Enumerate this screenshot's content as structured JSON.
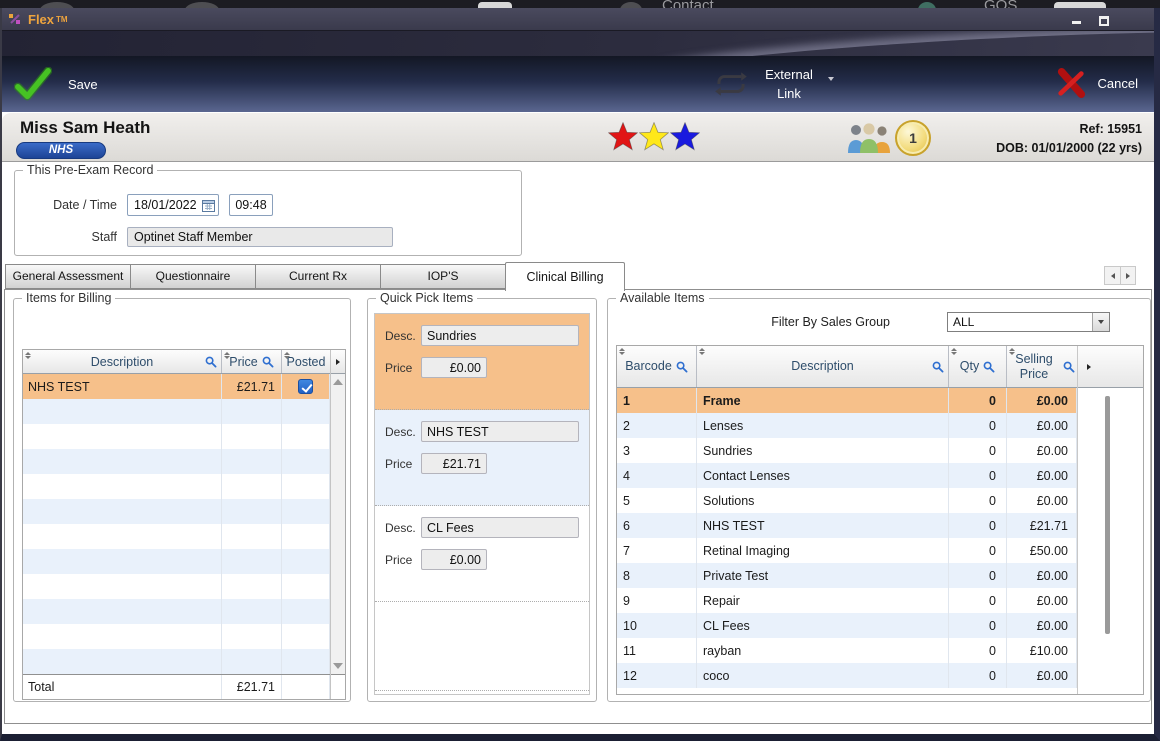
{
  "desktop": {
    "background_titles": [
      "Contact",
      "GOS"
    ]
  },
  "titlebar": {
    "app_name": "Flex",
    "trademark": "TM"
  },
  "toolbar": {
    "save": "Save",
    "external_link": "External Link",
    "cancel": "Cancel"
  },
  "patient": {
    "name": "Miss Sam Heath",
    "scheme_badge": "NHS",
    "ref": "Ref: 15951",
    "dob": "DOB: 01/01/2000 (22 yrs)",
    "link_count": "1",
    "star_colors": [
      "#e11515",
      "#ffe81a",
      "#1a1adf"
    ]
  },
  "pre_exam": {
    "legend": "This Pre-Exam Record",
    "date_time_label": "Date / Time",
    "date": "18/01/2022",
    "time": "09:48",
    "staff_label": "Staff",
    "staff": "Optinet Staff Member"
  },
  "tabs": {
    "items": [
      "General Assessment",
      "Questionnaire",
      "Current Rx",
      "IOP'S",
      "Clinical Billing"
    ],
    "active": "Clinical Billing"
  },
  "items_for_billing": {
    "legend": "Items for Billing",
    "columns": {
      "description": "Description",
      "price": "Price",
      "posted": "Posted"
    },
    "rows": [
      {
        "description": "NHS TEST",
        "price": "£21.71",
        "posted": true,
        "selected": true
      }
    ],
    "visible_rows": 12,
    "total_label": "Total",
    "total": "£21.71"
  },
  "quick_pick": {
    "legend": "Quick Pick Items",
    "desc_label": "Desc.",
    "price_label": "Price",
    "items": [
      {
        "desc": "Sundries",
        "price": "£0.00",
        "highlight": "orange"
      },
      {
        "desc": "NHS TEST",
        "price": "£21.71",
        "highlight": "blue"
      },
      {
        "desc": "CL Fees",
        "price": "£0.00",
        "highlight": "none"
      }
    ]
  },
  "available_items": {
    "legend": "Available Items",
    "filter_label": "Filter By Sales Group",
    "filter_value": "ALL",
    "columns": {
      "barcode": "Barcode",
      "description": "Description",
      "qty": "Qty",
      "selling_price": "Selling Price"
    },
    "rows": [
      {
        "barcode": "1",
        "description": "Frame",
        "qty": "0",
        "price": "£0.00",
        "selected": true
      },
      {
        "barcode": "2",
        "description": "Lenses",
        "qty": "0",
        "price": "£0.00"
      },
      {
        "barcode": "3",
        "description": "Sundries",
        "qty": "0",
        "price": "£0.00"
      },
      {
        "barcode": "4",
        "description": "Contact Lenses",
        "qty": "0",
        "price": "£0.00"
      },
      {
        "barcode": "5",
        "description": "Solutions",
        "qty": "0",
        "price": "£0.00"
      },
      {
        "barcode": "6",
        "description": "NHS TEST",
        "qty": "0",
        "price": "£21.71"
      },
      {
        "barcode": "7",
        "description": "Retinal Imaging",
        "qty": "0",
        "price": "£50.00"
      },
      {
        "barcode": "8",
        "description": "Private Test",
        "qty": "0",
        "price": "£0.00"
      },
      {
        "barcode": "9",
        "description": "Repair",
        "qty": "0",
        "price": "£0.00"
      },
      {
        "barcode": "10",
        "description": "CL Fees",
        "qty": "0",
        "price": "£0.00"
      },
      {
        "barcode": "11",
        "description": "rayban",
        "qty": "0",
        "price": "£10.00"
      },
      {
        "barcode": "12",
        "description": "coco",
        "qty": "0",
        "price": "£0.00"
      }
    ]
  },
  "colors": {
    "selection_orange": "#f6c08a",
    "row_alt_blue": "#e9f1fb",
    "nhs_badge_blue": "#2353af",
    "posted_checkbox_blue": "#2a6fd6",
    "save_green": "#3db520",
    "cancel_red": "#d01818"
  }
}
